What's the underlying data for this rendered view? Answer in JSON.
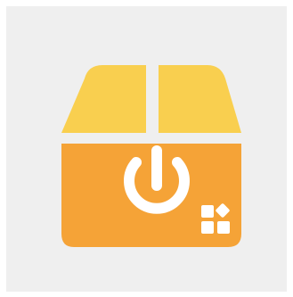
{
  "icon": {
    "name": "package-power-apps-icon",
    "colors": {
      "background": "#efefef",
      "lid": "#f9cf4f",
      "box_body": "#f5a337",
      "glyph": "#ffffff"
    }
  }
}
